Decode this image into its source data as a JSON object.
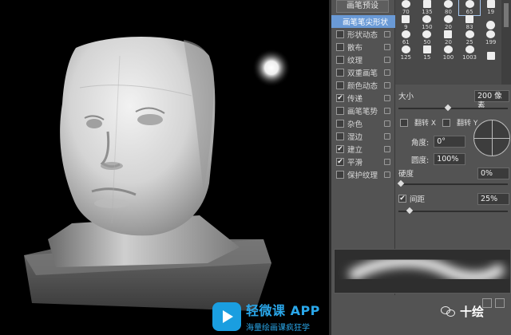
{
  "panel": {
    "preset_button": "画笔预设",
    "options": [
      {
        "label": "画笔笔尖形状",
        "checked": null,
        "active": true,
        "lock": false
      },
      {
        "label": "形状动态",
        "checked": false,
        "active": false,
        "lock": true
      },
      {
        "label": "散布",
        "checked": false,
        "active": false,
        "lock": true
      },
      {
        "label": "纹理",
        "checked": false,
        "active": false,
        "lock": true
      },
      {
        "label": "双重画笔",
        "checked": false,
        "active": false,
        "lock": true
      },
      {
        "label": "颜色动态",
        "checked": false,
        "active": false,
        "lock": true
      },
      {
        "label": "传递",
        "checked": true,
        "active": false,
        "lock": true
      },
      {
        "label": "画笔笔势",
        "checked": false,
        "active": false,
        "lock": true
      },
      {
        "label": "杂色",
        "checked": false,
        "active": false,
        "lock": true
      },
      {
        "label": "湿边",
        "checked": false,
        "active": false,
        "lock": true
      },
      {
        "label": "建立",
        "checked": true,
        "active": false,
        "lock": true
      },
      {
        "label": "平滑",
        "checked": true,
        "active": false,
        "lock": true
      },
      {
        "label": "保护纹理",
        "checked": false,
        "active": false,
        "lock": true
      }
    ]
  },
  "brush_grid": {
    "rows": [
      [
        "70",
        "135",
        "80",
        "65",
        "19"
      ],
      [
        "9",
        "150",
        "20",
        "83",
        ""
      ],
      [
        "61",
        "50",
        "20",
        "25",
        "199"
      ],
      [
        "125",
        "15",
        "100",
        "1003",
        ""
      ]
    ],
    "selected": "65"
  },
  "settings": {
    "size_label": "大小",
    "size_value": "200 像素",
    "size_fraction": 0.45,
    "flip_x": "翻转 X",
    "flip_y": "翻转 Y",
    "angle_label": "角度:",
    "angle_value": "0°",
    "roundness_label": "圆度:",
    "roundness_value": "100%",
    "hardness_label": "硬度",
    "hardness_value": "0%",
    "hardness_fraction": 0.0,
    "spacing_label": "间距",
    "spacing_value": "25%",
    "spacing_fraction": 0.1
  },
  "watermark": {
    "app_title": "轻微课 APP",
    "app_subtitle": "海量绘画课疯狂学",
    "brand": "十绘"
  },
  "colors": {
    "panel_bg": "#535353",
    "active_item": "#6a9ad6",
    "watermark_blue": "#2aa7ea"
  }
}
